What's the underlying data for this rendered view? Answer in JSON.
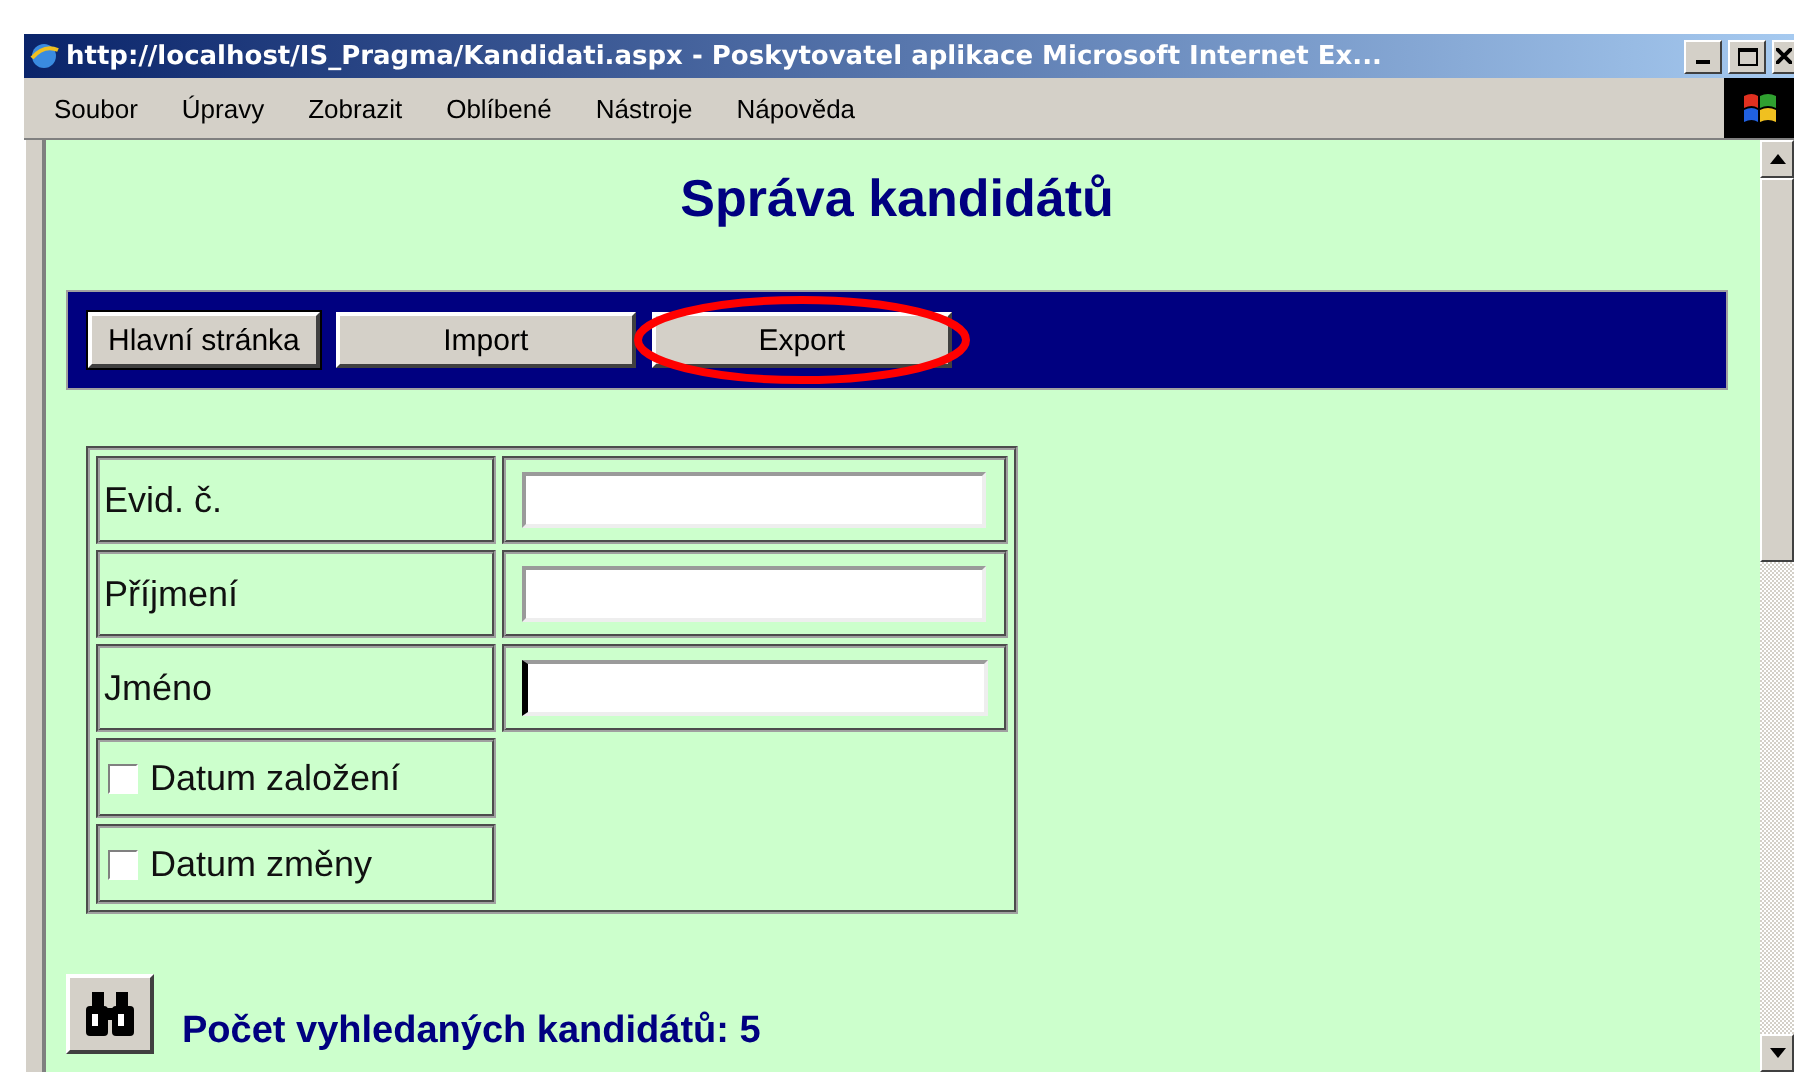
{
  "window": {
    "title": "http://localhost/IS_Pragma/Kandidati.aspx - Poskytovatel aplikace Microsoft Internet Ex..."
  },
  "menu": [
    {
      "label": "Soubor"
    },
    {
      "label": "Úpravy"
    },
    {
      "label": "Zobrazit"
    },
    {
      "label": "Oblíbené"
    },
    {
      "label": "Nástroje"
    },
    {
      "label": "Nápověda"
    }
  ],
  "page": {
    "heading": "Správa kandidátů",
    "nav_buttons": [
      {
        "label": "Hlavní stránka",
        "focused": true,
        "highlighted": false
      },
      {
        "label": "Import",
        "focused": false,
        "highlighted": false
      },
      {
        "label": "Export",
        "focused": false,
        "highlighted": true
      }
    ],
    "fields": [
      {
        "kind": "text",
        "label": "Evid. č.",
        "caret": false
      },
      {
        "kind": "text",
        "label": "Příjmení",
        "caret": false
      },
      {
        "kind": "text",
        "label": "Jméno",
        "caret": true
      },
      {
        "kind": "checkbox",
        "label": "Datum založení",
        "checked": false
      },
      {
        "kind": "checkbox",
        "label": "Datum změny",
        "checked": false
      }
    ],
    "result": "Počet vyhledaných kandidátů: 5"
  }
}
